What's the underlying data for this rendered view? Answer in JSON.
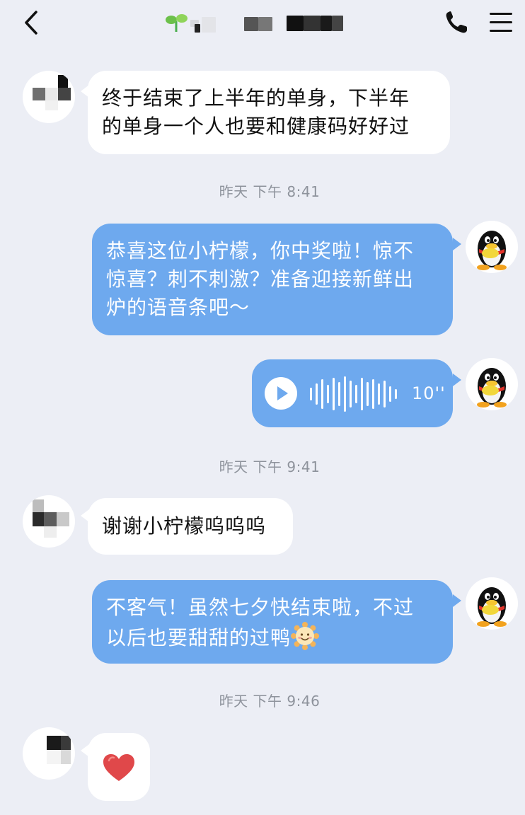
{
  "header": {
    "contact_name": "",
    "back_icon": "chevron-left-icon",
    "call_icon": "phone-icon",
    "menu_icon": "hamburger-menu-icon"
  },
  "colors": {
    "background": "#eceef5",
    "incoming_bubble": "#ffffff",
    "outgoing_bubble": "#6ea9ee",
    "timestamp": "#8e939c"
  },
  "messages": [
    {
      "type": "text",
      "direction": "in",
      "lines": [
        "终于结束了上半年的单身，下半年",
        "的单身一个人也要和健康码好好过"
      ]
    },
    {
      "type": "timestamp",
      "text": "昨天 下午 8:41"
    },
    {
      "type": "text",
      "direction": "out",
      "lines": [
        "恭喜这位小柠檬，你中奖啦！惊不",
        "惊喜？刺不刺激？准备迎接新鲜出",
        "炉的语音条吧～"
      ]
    },
    {
      "type": "voice",
      "direction": "out",
      "duration": "10''",
      "play_icon": "play-icon"
    },
    {
      "type": "timestamp",
      "text": "昨天 下午 9:41"
    },
    {
      "type": "text",
      "direction": "in",
      "lines": [
        "谢谢小柠檬呜呜呜"
      ]
    },
    {
      "type": "text",
      "direction": "out",
      "lines": [
        "不客气！虽然七夕快结束啦，不过",
        "以后也要甜甜的过鸭"
      ],
      "trailing_emoji": "sun-emoji-icon"
    },
    {
      "type": "timestamp",
      "text": "昨天 下午 9:46"
    },
    {
      "type": "sticker",
      "direction": "in",
      "icon": "heart-icon"
    }
  ]
}
